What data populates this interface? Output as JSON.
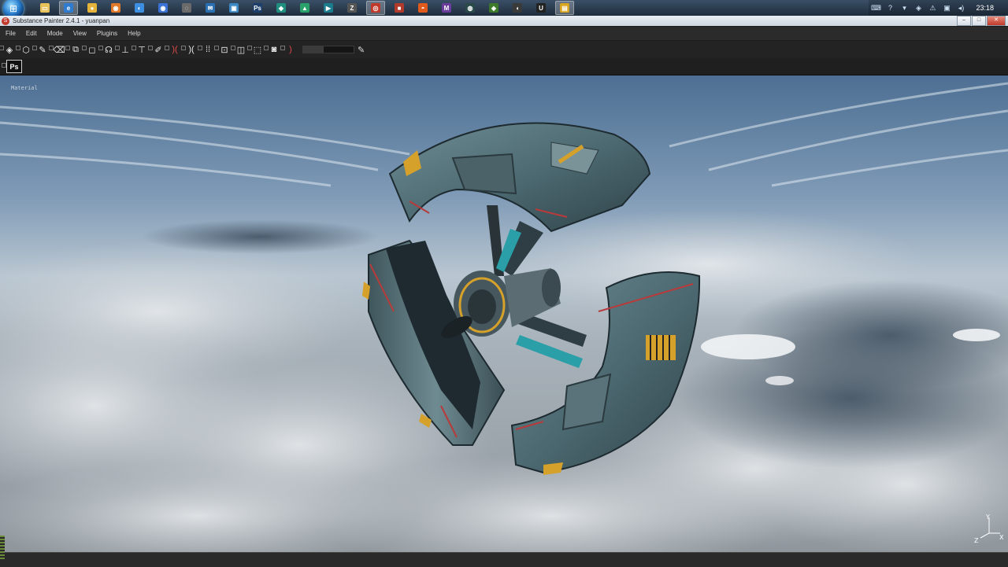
{
  "taskbar": {
    "start_label": "⊞",
    "apps": [
      {
        "name": "folder",
        "glyph": "▭",
        "color": "#e8c25a",
        "active": false
      },
      {
        "name": "browser-ie",
        "glyph": "e",
        "color": "#2f7bd0",
        "active": true
      },
      {
        "name": "chrome",
        "glyph": "●",
        "color": "#e4b43a",
        "active": false
      },
      {
        "name": "firefox",
        "glyph": "◉",
        "color": "#e07a28",
        "active": false
      },
      {
        "name": "browser-blue",
        "glyph": "◐",
        "color": "#3b8ee0",
        "active": false
      },
      {
        "name": "chrome2",
        "glyph": "◉",
        "color": "#3b72d6",
        "active": false
      },
      {
        "name": "disk",
        "glyph": "◌",
        "color": "#6a6a6a",
        "active": false
      },
      {
        "name": "mail",
        "glyph": "✉",
        "color": "#2b6fb3",
        "active": false
      },
      {
        "name": "photos",
        "glyph": "▣",
        "color": "#3b88c4",
        "active": false
      },
      {
        "name": "photoshop",
        "glyph": "Ps",
        "color": "#1b3f6a",
        "active": false
      },
      {
        "name": "app-teal",
        "glyph": "◆",
        "color": "#1f8f7f",
        "active": false
      },
      {
        "name": "app-green",
        "glyph": "▲",
        "color": "#2aa06a",
        "active": false
      },
      {
        "name": "app-cyan",
        "glyph": "▶",
        "color": "#1a7c8c",
        "active": false
      },
      {
        "name": "zbrush",
        "glyph": "Z",
        "color": "#555555",
        "active": false
      },
      {
        "name": "substance-painter",
        "glyph": "◎",
        "color": "#c0392b",
        "active": true
      },
      {
        "name": "app-red",
        "glyph": "■",
        "color": "#b23a2a",
        "active": false
      },
      {
        "name": "app-orange",
        "glyph": "◓",
        "color": "#e05a1c",
        "active": false
      },
      {
        "name": "app-purple",
        "glyph": "M",
        "color": "#6a3c9c",
        "active": false
      },
      {
        "name": "app-dark",
        "glyph": "◍",
        "color": "#2a4a4a",
        "active": false
      },
      {
        "name": "app-green2",
        "glyph": "◈",
        "color": "#3c7a2a",
        "active": false
      },
      {
        "name": "speaker",
        "glyph": "◖",
        "color": "#3a3a3a",
        "active": false
      },
      {
        "name": "unreal",
        "glyph": "U",
        "color": "#222222",
        "active": false
      },
      {
        "name": "explorer-yellow",
        "glyph": "▤",
        "color": "#d9a520",
        "active": true
      }
    ],
    "tray": [
      "⌨",
      "?",
      "▾",
      "◈",
      "⚠",
      "▣",
      "◂)"
    ],
    "clock": "23:18"
  },
  "window": {
    "app_icon": "S",
    "title": "Substance Painter 2.4.1 - yuanpan",
    "minimize": "–",
    "maximize": "□",
    "close": "✕"
  },
  "menu": [
    "File",
    "Edit",
    "Mode",
    "View",
    "Plugins",
    "Help"
  ],
  "toolbar": {
    "tools": [
      {
        "name": "layers-tool",
        "glyph": "◈"
      },
      {
        "name": "material-tool",
        "glyph": "⬡"
      },
      {
        "name": "paint-brush-tool",
        "glyph": "✎"
      },
      {
        "name": "eraser-tool",
        "glyph": "⌫"
      },
      {
        "name": "projection-tool",
        "glyph": "⧉"
      },
      {
        "name": "polygon-fill-tool",
        "glyph": "◻"
      },
      {
        "name": "smudge-tool",
        "glyph": "☊"
      },
      {
        "name": "clone-tool",
        "glyph": "⊥"
      },
      {
        "name": "stamp-tool",
        "glyph": "⊤"
      },
      {
        "name": "picker-tool",
        "glyph": "✐"
      },
      {
        "name": "symmetry-x-tool",
        "glyph": ")(",
        "red": true
      },
      {
        "name": "symmetry-y-tool",
        "glyph": ")("
      },
      {
        "name": "grid-tool",
        "glyph": "⁞⁞"
      },
      {
        "name": "uv-tool",
        "glyph": "⊡"
      },
      {
        "name": "camera-tool",
        "glyph": "◫"
      },
      {
        "name": "cube-tool",
        "glyph": "⬚"
      },
      {
        "name": "screenshot-tool",
        "glyph": "◙"
      },
      {
        "name": "bracket-tool",
        "glyph": ")",
        "red": true
      }
    ],
    "slider_fill_pct": 40,
    "photoshop_label": "Ps"
  },
  "viewport": {
    "mode_label": "Material",
    "axis_labels": {
      "x": "X",
      "y": "Y",
      "z": "Z"
    }
  }
}
